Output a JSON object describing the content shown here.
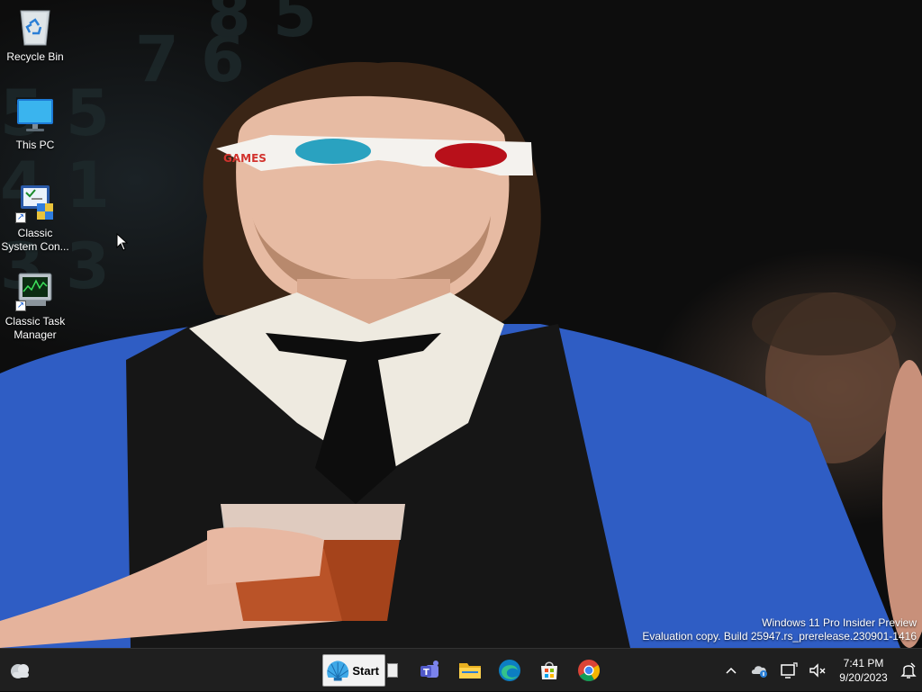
{
  "desktop": {
    "icons": [
      {
        "label": "Recycle Bin"
      },
      {
        "label": "This PC"
      },
      {
        "label": "Classic System Con..."
      },
      {
        "label": "Classic Task Manager"
      }
    ]
  },
  "watermark": {
    "line1": "Windows 11 Pro Insider Preview",
    "line2": "Evaluation copy. Build 25947.rs_prerelease.230901-1416"
  },
  "glasses_text": "GAMES",
  "taskbar": {
    "start_label": "Start",
    "apps": [
      "Microsoft Teams",
      "File Explorer",
      "Microsoft Edge",
      "Microsoft Store",
      "Google Chrome"
    ],
    "clock": {
      "time": "7:41 PM",
      "date": "9/20/2023"
    }
  },
  "colors": {
    "taskbar_bg": "#1f1f1f",
    "accent_blue": "#2f5dc4"
  }
}
